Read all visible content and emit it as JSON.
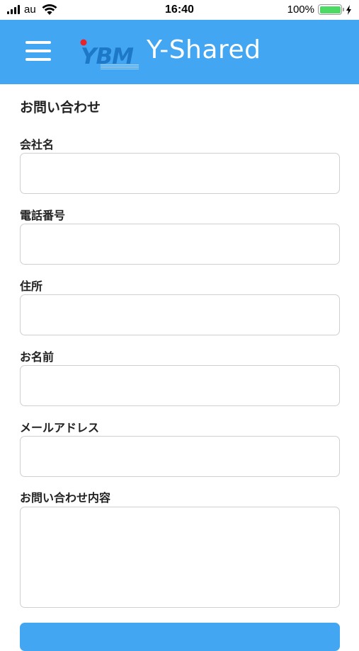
{
  "status_bar": {
    "carrier": "au",
    "time": "16:40",
    "battery_percent": "100%"
  },
  "header": {
    "logo_text": "YBM",
    "title": "Y-Shared"
  },
  "form": {
    "title": "お問い合わせ",
    "fields": [
      {
        "label": "会社名",
        "value": "",
        "placeholder": ""
      },
      {
        "label": "電話番号",
        "value": "",
        "placeholder": ""
      },
      {
        "label": "住所",
        "value": "",
        "placeholder": ""
      },
      {
        "label": "お名前",
        "value": "",
        "placeholder": ""
      },
      {
        "label": "メールアドレス",
        "value": "",
        "placeholder": ""
      },
      {
        "label": "お問い合わせ内容",
        "value": "",
        "placeholder": ""
      }
    ]
  },
  "colors": {
    "header_bg": "#43a6f2",
    "logo_red": "#e8232a",
    "battery_green": "#4cd964"
  }
}
